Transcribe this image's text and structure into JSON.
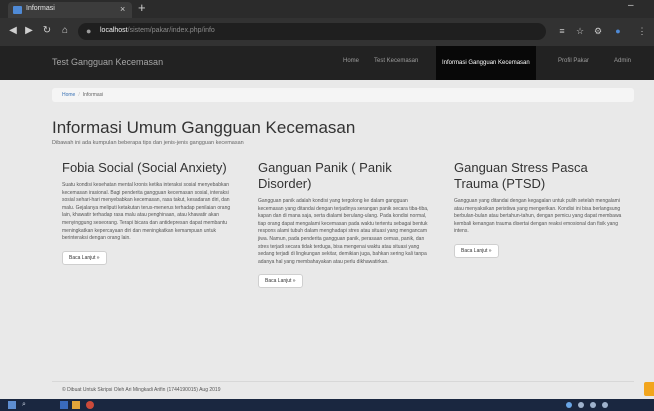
{
  "browser": {
    "tab_title": "Informasi",
    "tab_close": "×",
    "new_tab": "+",
    "window_min": "–",
    "url_host": "localhost",
    "url_path": "/sistem/pakar/index.php/info",
    "icons": [
      "back-icon",
      "forward-icon",
      "reload-icon",
      "home-icon",
      "lock-icon",
      "menu-icon",
      "star-icon",
      "extension-icon",
      "profile-icon"
    ]
  },
  "site": {
    "brand": "Test Gangguan Kecemasan",
    "nav": [
      {
        "label": "Home"
      },
      {
        "label": "Test Kecemasan"
      },
      {
        "label": "Informasi Gangguan Kecemasan",
        "active": true
      },
      {
        "label": "Profil Pakar"
      },
      {
        "label": "Admin"
      }
    ]
  },
  "breadcrumb": {
    "home": "Home",
    "sep": "/",
    "current": "Informasi"
  },
  "page": {
    "title": "Informasi Umum Gangguan Kecemasan",
    "subtitle": "Dibawah ini ada kumpulan beberapa tips dan jenis-jenis gangguan kecemasan"
  },
  "columns": [
    {
      "title": "Fobia Social (Social Anxiety)",
      "body": "Suatu kondisi kesehatan mental kronis ketika interaksi sosial menyebabkan kecemasan irasional. Bagi penderita gangguan kecemasan sosial, interaksi sosial sehari-hari menyebabkan kecemasan, rasa takut, kesadaran diri, dan malu. Gejalanya meliputi ketakutan terus-menerus terhadap penilaian orang lain, khawatir terhadap rasa malu atau penghinaan, atau khawatir akan menyinggung seseorang. Terapi bicara dan antidepresan dapat membantu meningkatkan kepercayaan diri dan meningkatkan kemampuan untuk berinteraksi dengan orang lain.",
      "button": "Baca Lanjut »"
    },
    {
      "title": "Ganguan Panik ( Panik Disorder)",
      "body": "Gangguan panik adalah kondisi yang tergolong ke dalam gangguan kecemasan yang ditandai dengan terjadinya serangan panik secara tiba-tiba, kapan dan di mana saja, serta dialami berulang-ulang. Pada kondisi normal, tiap orang dapat mengalami kecemasan pada waktu tertentu sebagai bentuk respons alami tubuh dalam menghadapi stres atau situasi yang mengancam jiwa. Namun, pada penderita gangguan panik, perasaan cemas, panik, dan stres terjadi secara tidak terduga, bisa mengenai waktu atau situasi yang sedang terjadi di lingkungan sekitar, demikian juga, bahkan sering kali tanpa adanya hal yang membahayakan atau perlu dikhawatirkan.",
      "button": "Baca Lanjut »"
    },
    {
      "title": "Ganguan Stress Pasca Trauma (PTSD)",
      "body": "Gangguan yang ditandai dengan kegagalan untuk pulih setelah mengalami atau menyaksikan peristiwa yang mengerikan. Kondisi ini bisa berlangsung berbulan-bulan atau bertahun-tahun, dengan pemicu yang dapat membawa kembali kenangan trauma disertai dengan reaksi emosional dan fisik yang intens.",
      "button": "Baca Lanjut »"
    }
  ],
  "footer": {
    "text": "© Dibuat Untuk Skripsi Oleh Ari Mingkadi Arifin (1744190015) Aug 2019"
  }
}
